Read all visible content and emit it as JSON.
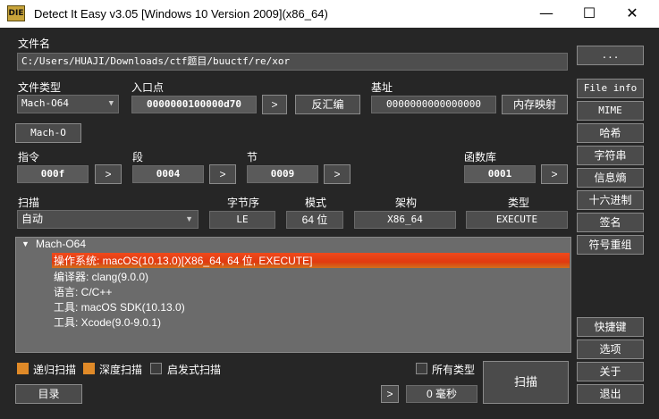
{
  "window": {
    "title": "Detect It Easy v3.05 [Windows 10 Version 2009](x86_64)",
    "icon_text": "DIE",
    "minimize": "—",
    "maximize": "☐",
    "close": "✕"
  },
  "file": {
    "label": "文件名",
    "path": "C:/Users/HUAJI/Downloads/ctf题目/buuctf/re/xor",
    "browse": "..."
  },
  "type": {
    "label": "文件类型",
    "value": "Mach-O64",
    "entry_label": "入口点",
    "entry_value": "0000000100000d70",
    "entry_go": ">",
    "disasm": "反汇编",
    "base_label": "基址",
    "base_value": "0000000000000000",
    "memmap": "内存映射"
  },
  "format_button": "Mach-O",
  "counts": {
    "cmd_label": "指令",
    "cmd_value": "000f",
    "seg_label": "段",
    "seg_value": "0004",
    "sec_label": "节",
    "sec_value": "0009",
    "lib_label": "函数库",
    "lib_value": "0001",
    "go": ">"
  },
  "scan": {
    "label": "扫描",
    "mode": "自动",
    "endian_label": "字节序",
    "endian_value": "LE",
    "mode_label": "模式",
    "mode_value": "64 位",
    "arch_label": "架构",
    "arch_value": "X86_64",
    "type_label": "类型",
    "type_value": "EXECUTE"
  },
  "results": {
    "root": "Mach-O64",
    "expander": "▼",
    "items": [
      "操作系统: macOS(10.13.0)[X86_64, 64 位, EXECUTE]",
      "编译器: clang(9.0.0)",
      "语言: C/C++",
      "工具: macOS SDK(10.13.0)",
      "工具: Xcode(9.0-9.0.1)"
    ]
  },
  "options": {
    "recursive": "递归扫描",
    "deep": "深度扫描",
    "heuristic": "启发式扫描",
    "all_types": "所有类型"
  },
  "bottom": {
    "directory": "目录",
    "next": ">",
    "time": "0 毫秒",
    "scan": "扫描"
  },
  "sidebar": {
    "file_info": "File info",
    "mime": "MIME",
    "hash": "哈希",
    "strings": "字符串",
    "entropy": "信息熵",
    "hex": "十六进制",
    "signatures": "签名",
    "demangle": "符号重组",
    "shortcuts": "快捷键",
    "options": "选项",
    "about": "关于",
    "exit": "退出"
  },
  "colors": {
    "accent_checkbox": "#e08a28",
    "highlight": "#e03a10",
    "background": "#262626"
  }
}
